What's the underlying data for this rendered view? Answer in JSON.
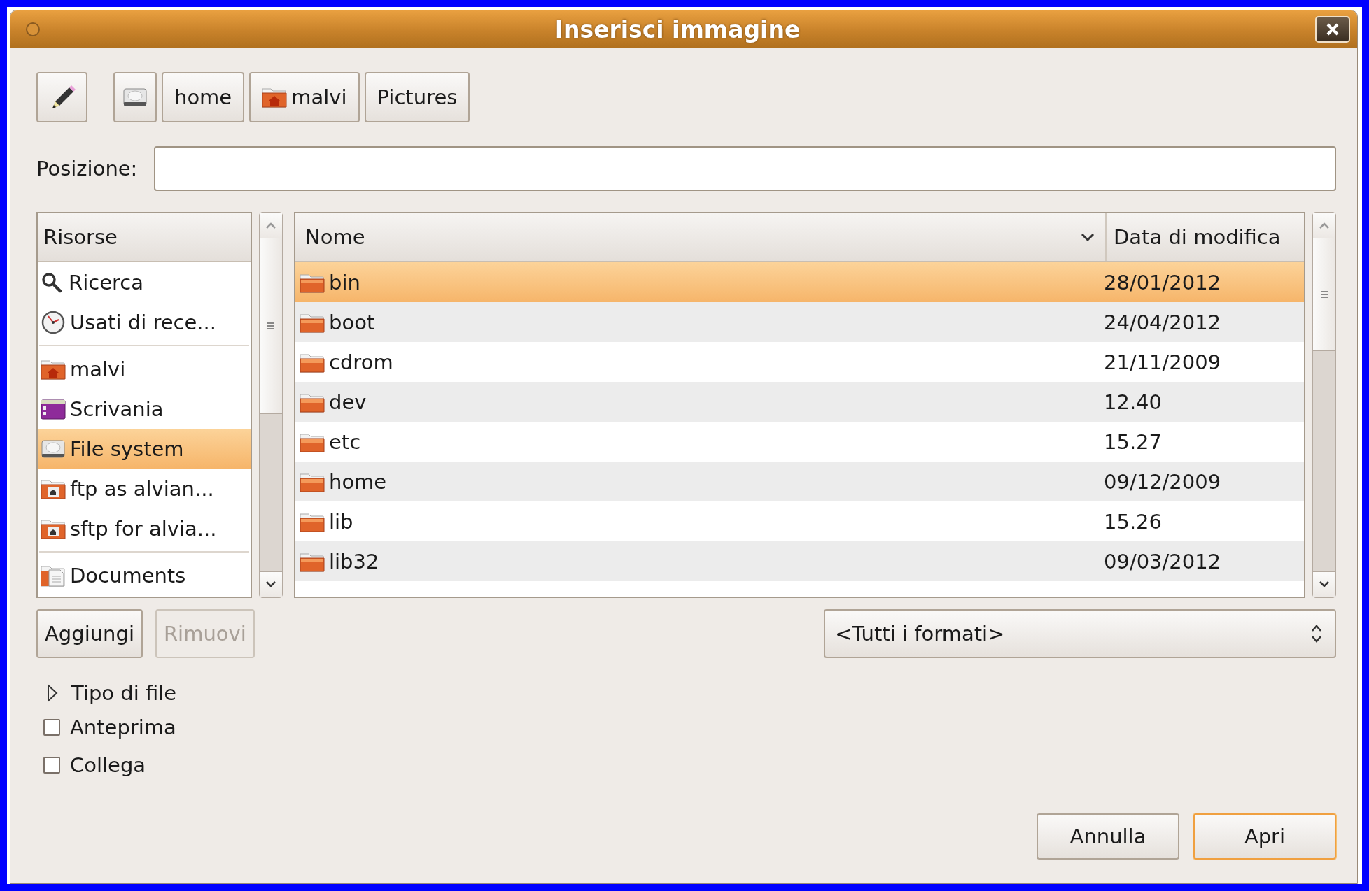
{
  "window": {
    "title": "Inserisci immagine"
  },
  "path_bar": {
    "buttons": [
      {
        "kind": "drive"
      },
      {
        "kind": "text",
        "label": "home"
      },
      {
        "kind": "home-folder",
        "label": "malvi"
      },
      {
        "kind": "text",
        "label": "Pictures"
      }
    ]
  },
  "location": {
    "label": "Posizione:"
  },
  "places": {
    "header": "Risorse",
    "groups": [
      [
        {
          "kind": "search",
          "label": "Ricerca",
          "selected": false
        },
        {
          "kind": "recent",
          "label": "Usati di rece...",
          "selected": false
        }
      ],
      [
        {
          "kind": "home",
          "label": "malvi",
          "selected": false
        },
        {
          "kind": "desktop",
          "label": "Scrivania",
          "selected": false
        },
        {
          "kind": "drive",
          "label": "File system",
          "selected": true
        },
        {
          "kind": "remote",
          "label": "ftp as alvian...",
          "selected": false
        },
        {
          "kind": "remote",
          "label": "sftp for alvia...",
          "selected": false
        }
      ],
      [
        {
          "kind": "documents",
          "label": "Documents",
          "selected": false
        }
      ]
    ]
  },
  "files": {
    "columns": [
      "Nome",
      "Data di modifica"
    ],
    "rows": [
      {
        "name": "bin",
        "modified": "28/01/2012",
        "selected": true
      },
      {
        "name": "boot",
        "modified": "24/04/2012",
        "selected": false
      },
      {
        "name": "cdrom",
        "modified": "21/11/2009",
        "selected": false
      },
      {
        "name": "dev",
        "modified": "12.40",
        "selected": false
      },
      {
        "name": "etc",
        "modified": "15.27",
        "selected": false
      },
      {
        "name": "home",
        "modified": "09/12/2009",
        "selected": false
      },
      {
        "name": "lib",
        "modified": "15.26",
        "selected": false
      },
      {
        "name": "lib32",
        "modified": "09/03/2012",
        "selected": false
      }
    ]
  },
  "place_buttons": [
    {
      "label": "Aggiungi",
      "disabled": false
    },
    {
      "label": "Rimuovi",
      "disabled": true
    }
  ],
  "filter": {
    "value": "<Tutti i formati>"
  },
  "expander": {
    "label": "Tipo di file",
    "expanded": false
  },
  "options": [
    {
      "label": "Anteprima",
      "checked": false
    },
    {
      "label": "Collega",
      "checked": false
    }
  ],
  "actions": [
    {
      "label": "Annulla",
      "default": false
    },
    {
      "label": "Apri",
      "default": true
    }
  ]
}
